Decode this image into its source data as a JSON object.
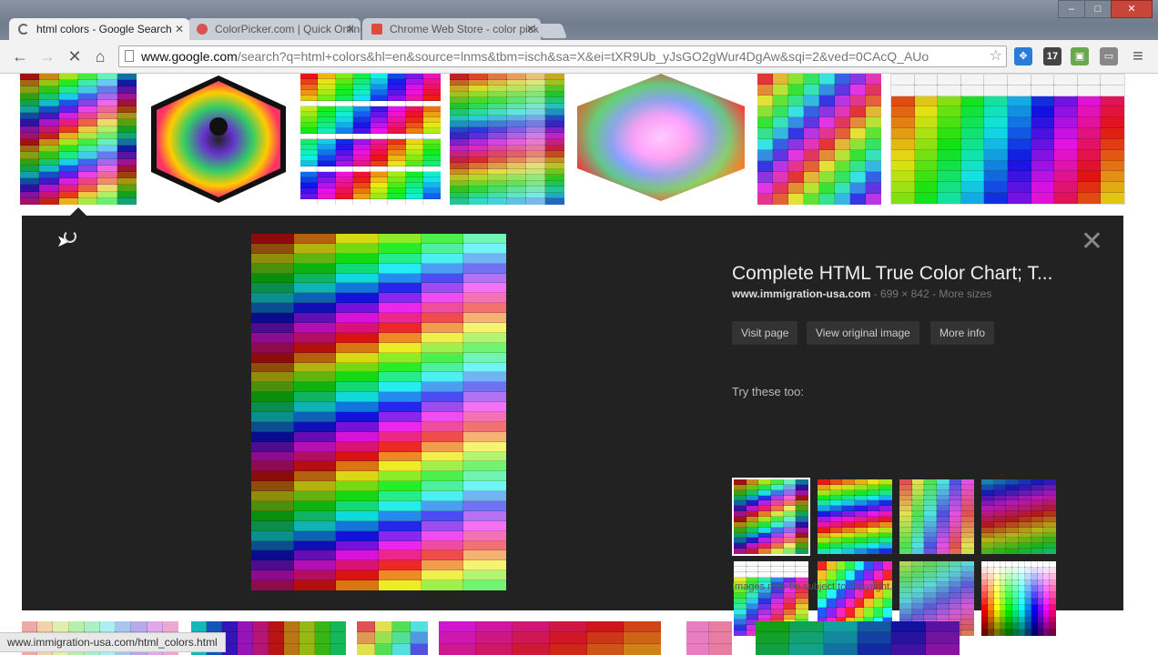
{
  "window": {
    "controls": [
      "–",
      "□",
      "✕"
    ]
  },
  "tabs": [
    {
      "label": "html colors - Google Search",
      "favicon_color": "#4285f4",
      "active": true
    },
    {
      "label": "ColorPicker.com | Quick Online Color Picker",
      "favicon_color": "#d9534f",
      "active": false
    },
    {
      "label": "Chrome Web Store - color picker",
      "favicon_color": "#dd4b39",
      "active": false
    }
  ],
  "toolbar": {
    "back": "←",
    "forward": "→",
    "stop": "✕",
    "home": "⌂",
    "url_host": "www.google.com",
    "url_rest": "/search?q=html+colors&hl=en&source=lnms&tbm=isch&sa=X&ei=tXR9Ub_yJsGO2gWur4DgAw&sqi=2&ved=0CAcQ_AUo",
    "star": "☆",
    "menu": "≡"
  },
  "extensions": [
    {
      "icon": "colorpicker-extension-icon",
      "color": "#2a7ad8",
      "glyph": "✥"
    },
    {
      "icon": "notification-extension-icon",
      "color": "#444444",
      "glyph": "17"
    },
    {
      "icon": "android-extension-icon",
      "color": "#6aa84f",
      "glyph": "▣"
    },
    {
      "icon": "cast-extension-icon",
      "color": "#666666",
      "glyph": "▭"
    }
  ],
  "preview": {
    "title": "Complete HTML True Color Chart; T...",
    "site": "www.immigration-usa.com",
    "dimensions": "699 × 842",
    "more_sizes": "More sizes",
    "buttons": [
      "Visit page",
      "View original image",
      "More info"
    ],
    "try_label": "Try these too:",
    "notice": "Images may be subject to copyright.",
    "close": "✕"
  },
  "status_bar": "www.immigration-usa.com/html_colors.html"
}
